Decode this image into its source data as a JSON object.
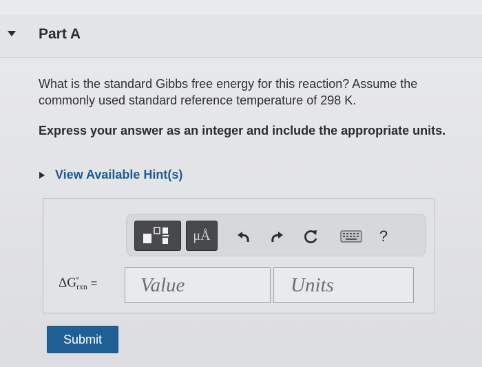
{
  "part": {
    "title": "Part A"
  },
  "question": {
    "text": "What is the standard Gibbs free energy for this reaction? Assume the commonly used standard reference temperature of 298 K.",
    "instruction": "Express your answer as an integer and include the appropriate units."
  },
  "hint": {
    "label": "View Available Hint(s)"
  },
  "toolbar": {
    "units_label": "μÅ",
    "help_label": "?",
    "icons": [
      "templates-icon",
      "units-icon",
      "undo-icon",
      "redo-icon",
      "reset-icon",
      "keyboard-icon",
      "help-icon"
    ]
  },
  "answer": {
    "delta": "ΔG",
    "degree": "∘",
    "subscript": "rxn",
    "equals": "=",
    "value_placeholder": "Value",
    "units_placeholder": "Units"
  },
  "submit": {
    "label": "Submit"
  },
  "colors": {
    "link": "#1f5a9a",
    "submit_bg": "#1e5f95",
    "toolbar_dark": "#48494d"
  }
}
